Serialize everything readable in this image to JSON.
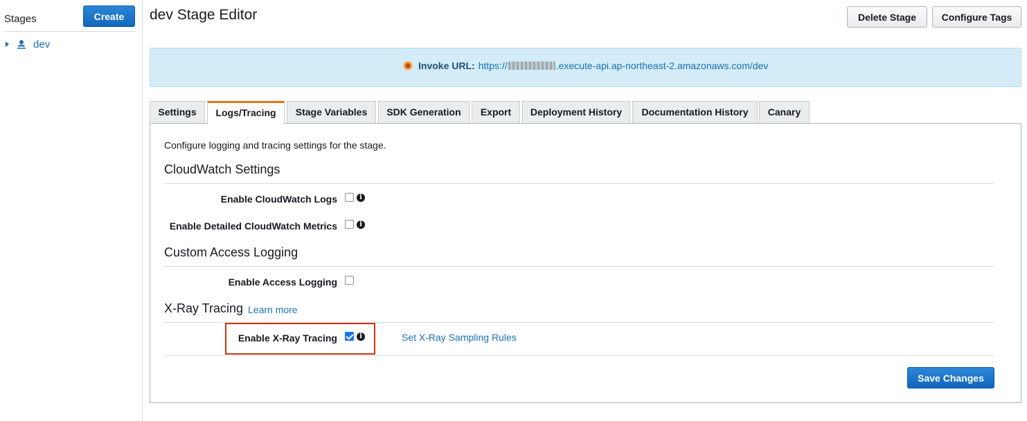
{
  "sidebar": {
    "title": "Stages",
    "create_label": "Create",
    "stages": [
      {
        "label": "dev"
      }
    ]
  },
  "header": {
    "title": "dev Stage Editor",
    "delete_label": "Delete Stage",
    "tags_label": "Configure Tags"
  },
  "invoke": {
    "label": "Invoke URL:",
    "url_prefix": "https://",
    "url_suffix": ".execute-api.ap-northeast-2.amazonaws.com/dev"
  },
  "tabs": [
    {
      "label": "Settings",
      "active": false
    },
    {
      "label": "Logs/Tracing",
      "active": true
    },
    {
      "label": "Stage Variables",
      "active": false
    },
    {
      "label": "SDK Generation",
      "active": false
    },
    {
      "label": "Export",
      "active": false
    },
    {
      "label": "Deployment History",
      "active": false
    },
    {
      "label": "Documentation History",
      "active": false
    },
    {
      "label": "Canary",
      "active": false
    }
  ],
  "panel": {
    "description": "Configure logging and tracing settings for the stage.",
    "cloudwatch": {
      "title": "CloudWatch Settings",
      "logs_label": "Enable CloudWatch Logs",
      "logs_checked": false,
      "metrics_label": "Enable Detailed CloudWatch Metrics",
      "metrics_checked": false
    },
    "access_logging": {
      "title": "Custom Access Logging",
      "enable_label": "Enable Access Logging",
      "enable_checked": false
    },
    "xray": {
      "title": "X-Ray Tracing",
      "learn_more": "Learn more",
      "enable_label": "Enable X-Ray Tracing",
      "enable_checked": true,
      "sampling_link": "Set X-Ray Sampling Rules"
    },
    "save_label": "Save Changes"
  },
  "colors": {
    "accent": "#ec7211",
    "link": "#1a6fb5",
    "primary_button": "#1166bb",
    "banner_bg": "#d3ecf7",
    "highlight": "#d13212"
  },
  "icons": {
    "stage": "stage-tree-icon",
    "status": "status-dot-icon",
    "info": "info-icon"
  }
}
